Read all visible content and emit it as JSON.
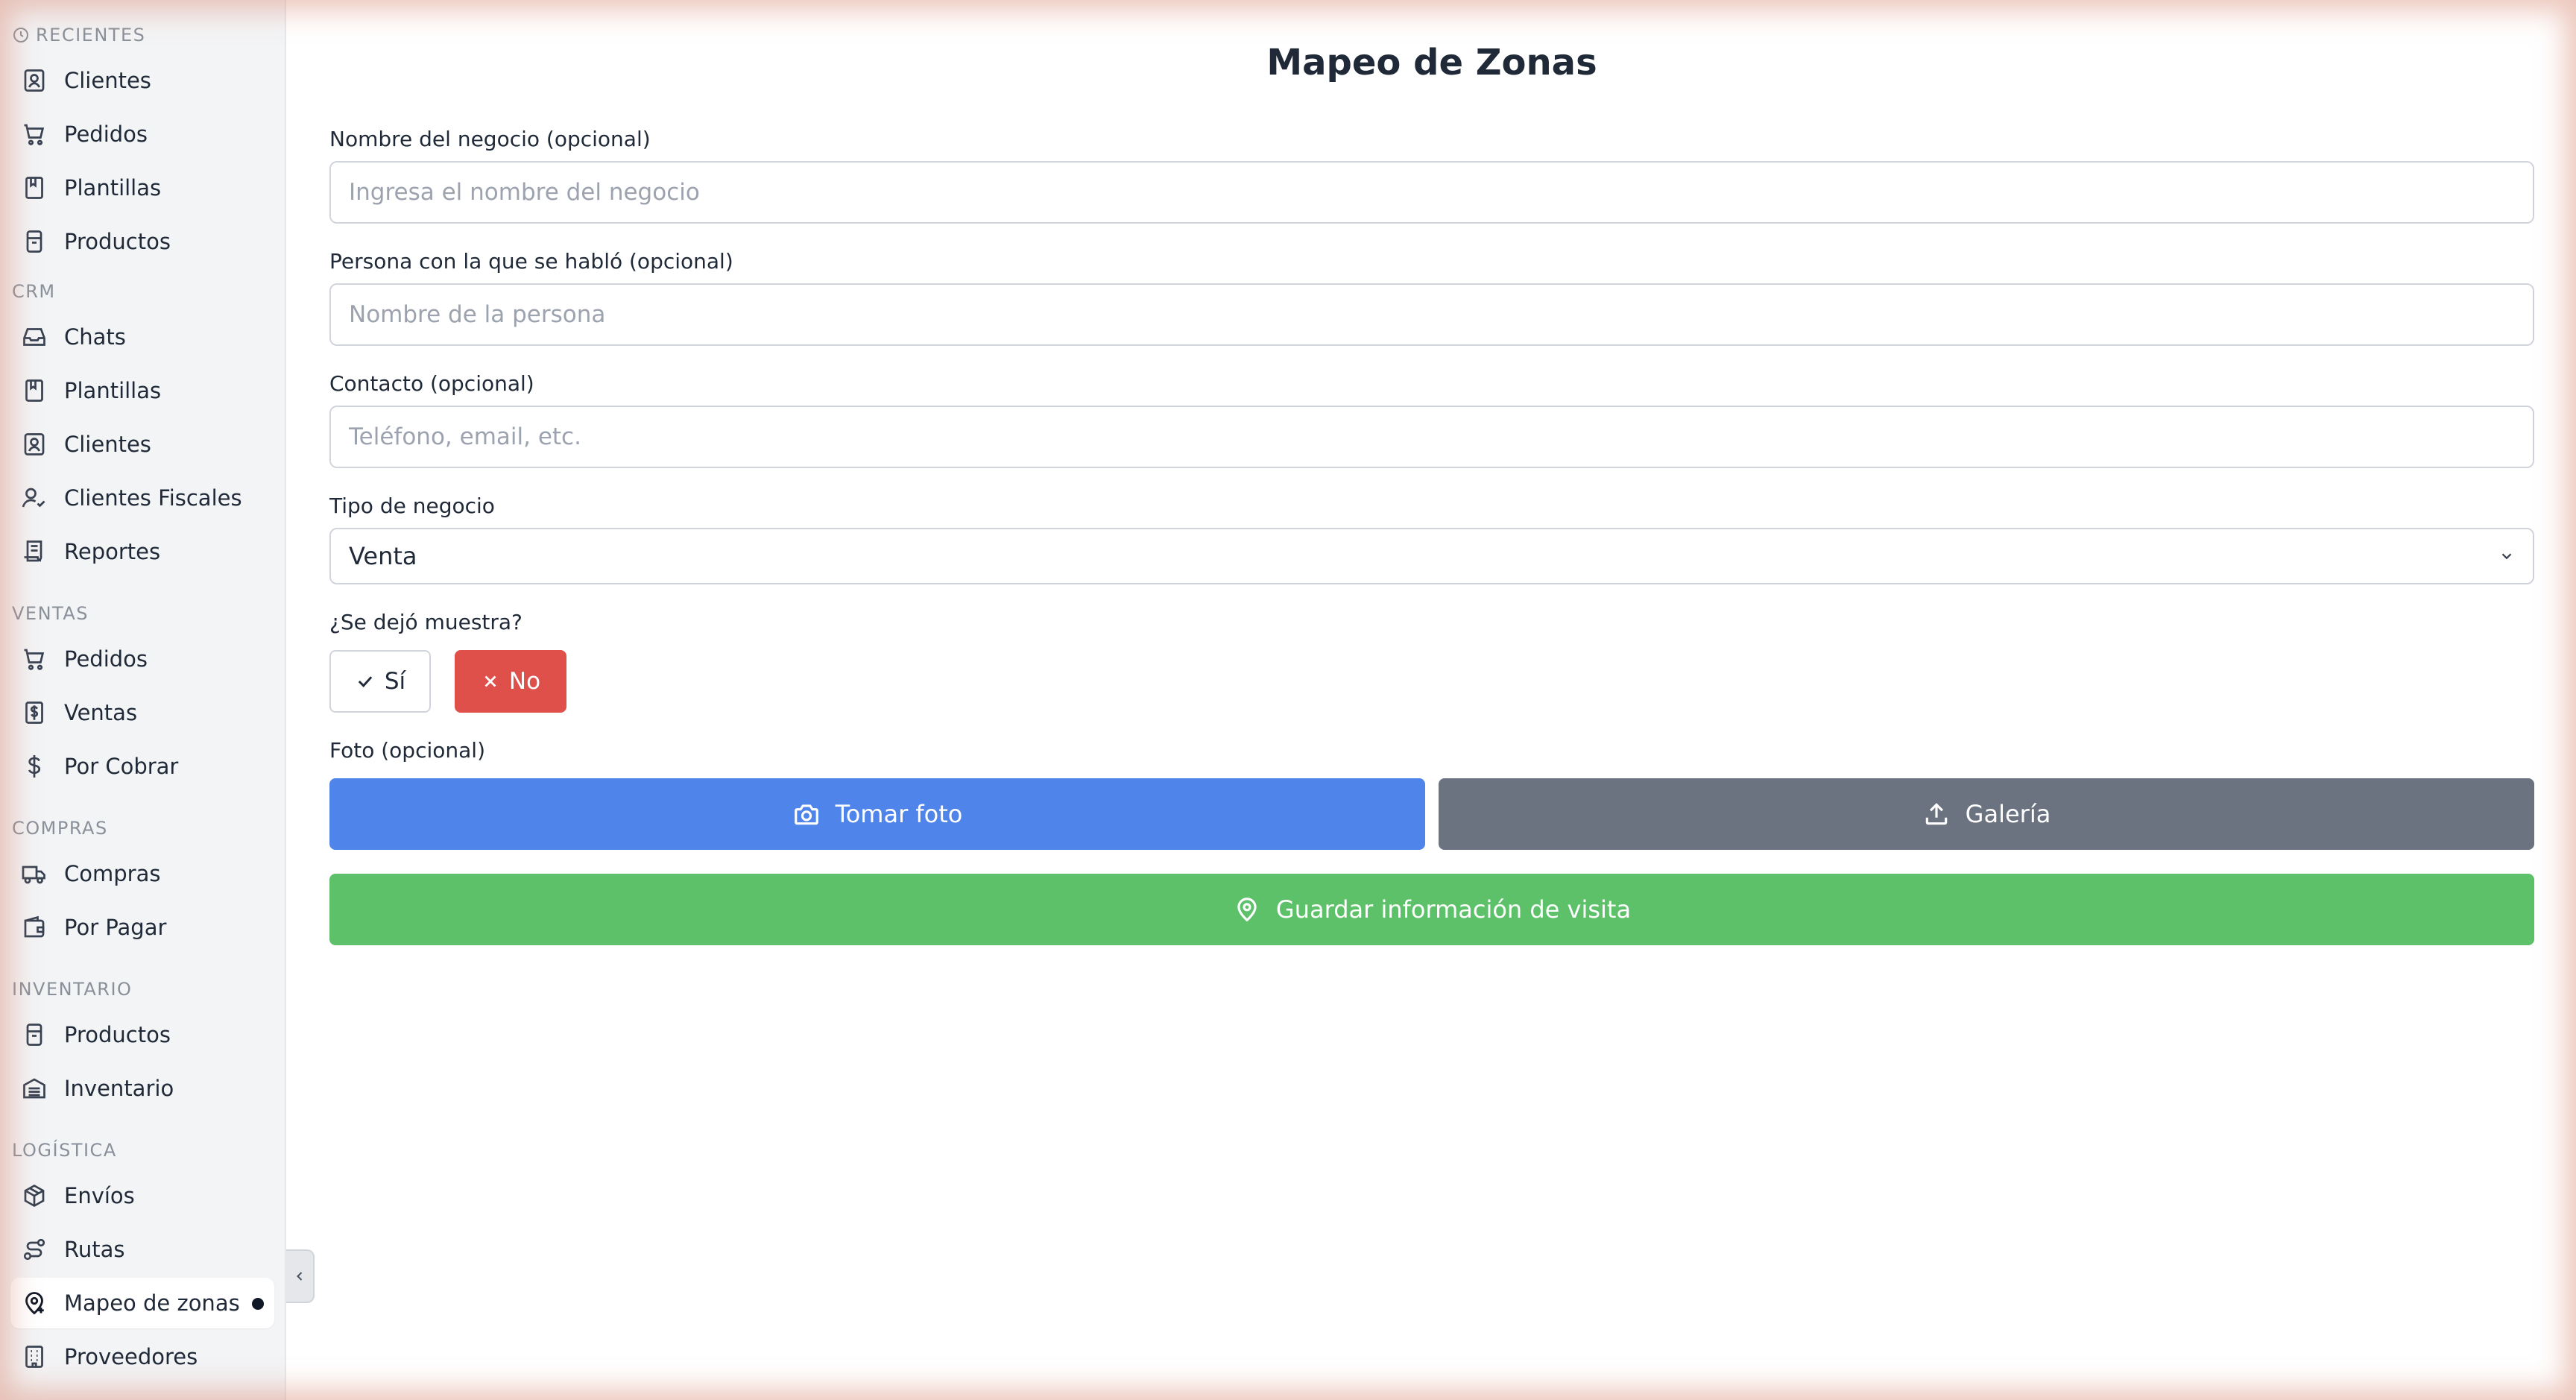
{
  "sidebar": {
    "sections": [
      {
        "title": "RECIENTES",
        "items": [
          "Clientes",
          "Pedidos",
          "Plantillas",
          "Productos"
        ]
      },
      {
        "title": "CRM",
        "items": [
          "Chats",
          "Plantillas",
          "Clientes",
          "Clientes Fiscales",
          "Reportes"
        ]
      },
      {
        "title": "VENTAS",
        "items": [
          "Pedidos",
          "Ventas",
          "Por Cobrar"
        ]
      },
      {
        "title": "COMPRAS",
        "items": [
          "Compras",
          "Por Pagar"
        ]
      },
      {
        "title": "INVENTARIO",
        "items": [
          "Productos",
          "Inventario"
        ]
      },
      {
        "title": "LOGÍSTICA",
        "items": [
          "Envíos",
          "Rutas",
          "Mapeo de zonas",
          "Proveedores"
        ]
      }
    ],
    "active_item": "Mapeo de zonas"
  },
  "main": {
    "title": "Mapeo de Zonas",
    "business_name": {
      "label": "Nombre del negocio (opcional)",
      "placeholder": "Ingresa el nombre del negocio",
      "value": ""
    },
    "contact_person": {
      "label": "Persona con la que se habló (opcional)",
      "placeholder": "Nombre de la persona",
      "value": ""
    },
    "contact": {
      "label": "Contacto (opcional)",
      "placeholder": "Teléfono, email, etc.",
      "value": ""
    },
    "business_type": {
      "label": "Tipo de negocio",
      "value": "Venta"
    },
    "sample": {
      "label": "¿Se dejó muestra?",
      "yes": "Sí",
      "no": "No",
      "selected": "No"
    },
    "photo": {
      "label": "Foto (opcional)",
      "camera": "Tomar foto",
      "gallery": "Galería"
    },
    "save": "Guardar información de visita"
  },
  "colors": {
    "primary_blue": "#4f84ea",
    "gray_button": "#6b7280",
    "save_green": "#5cc169",
    "no_red": "#e0504a"
  }
}
